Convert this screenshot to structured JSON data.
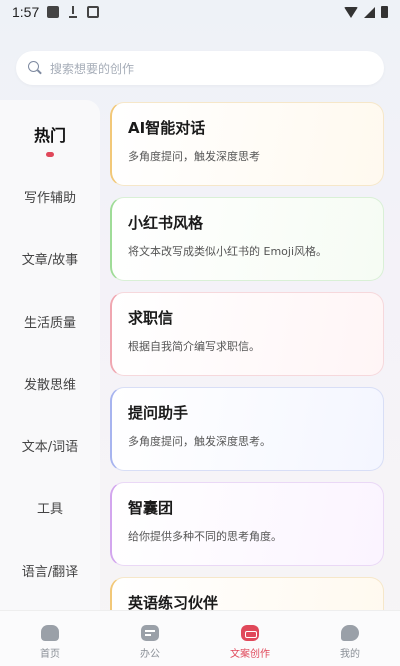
{
  "status_bar": {
    "time": "1:57"
  },
  "search": {
    "placeholder": "搜索想要的创作"
  },
  "sidebar": {
    "items": [
      {
        "label": "热门",
        "active": true
      },
      {
        "label": "写作辅助"
      },
      {
        "label": "文章/故事"
      },
      {
        "label": "生活质量"
      },
      {
        "label": "发散思维"
      },
      {
        "label": "文本/词语"
      },
      {
        "label": "工具"
      },
      {
        "label": "语言/翻译"
      }
    ]
  },
  "cards": [
    {
      "title": "AI智能对话",
      "desc": "多角度提问，触发深度思考"
    },
    {
      "title": "小红书风格",
      "desc": "将文本改写成类似小红书的 Emoji风格。"
    },
    {
      "title": "求职信",
      "desc": "根据自我简介编写求职信。"
    },
    {
      "title": "提问助手",
      "desc": "多角度提问，触发深度思考。"
    },
    {
      "title": "智囊团",
      "desc": "给你提供多种不同的思考角度。"
    },
    {
      "title": "英语练习伙伴",
      "desc": ""
    }
  ],
  "bottom_nav": {
    "items": [
      {
        "label": "首页",
        "icon": "home-icon"
      },
      {
        "label": "办公",
        "icon": "office-icon"
      },
      {
        "label": "文案创作",
        "icon": "copywriting-icon",
        "active": true
      },
      {
        "label": "我的",
        "icon": "profile-icon"
      }
    ]
  },
  "colors": {
    "accent": "#e0485a"
  }
}
